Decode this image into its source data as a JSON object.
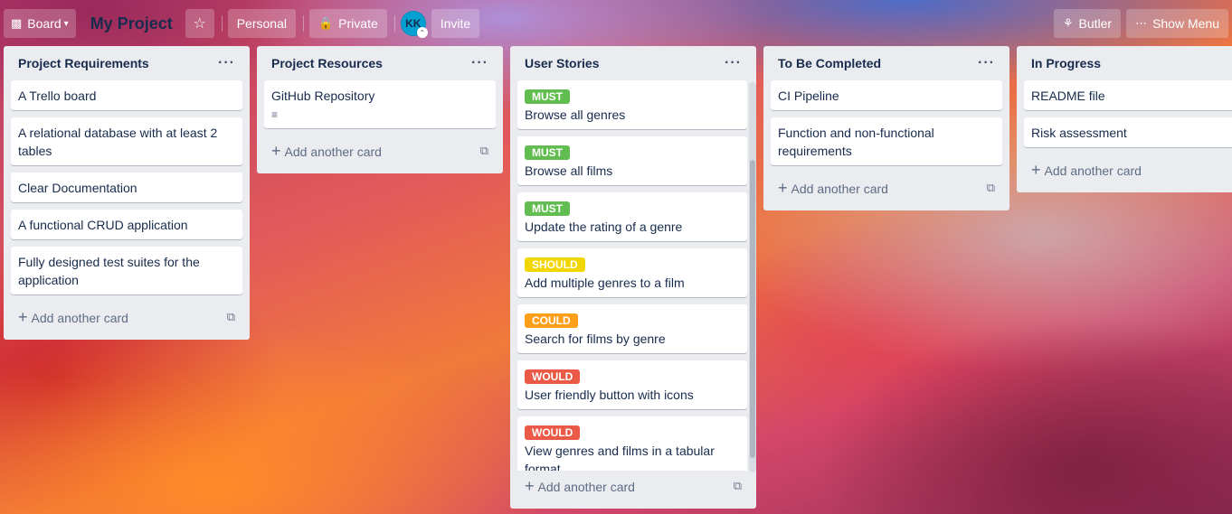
{
  "header": {
    "board_switcher": "Board",
    "board_title": "My Project",
    "team": "Personal",
    "visibility": "Private",
    "avatar_initials": "KK",
    "invite": "Invite",
    "butler": "Butler",
    "show_menu": "Show Menu"
  },
  "common": {
    "add_card": "Add another card"
  },
  "lists": [
    {
      "title": "Project Requirements",
      "cards": [
        {
          "text": "A Trello board"
        },
        {
          "text": "A relational database with at least 2 tables"
        },
        {
          "text": "Clear Documentation"
        },
        {
          "text": "A functional CRUD application"
        },
        {
          "text": "Fully designed test suites for the application"
        }
      ]
    },
    {
      "title": "Project Resources",
      "cards": [
        {
          "text": "GitHub Repository",
          "has_description": true
        }
      ]
    },
    {
      "title": "User Stories",
      "cards": [
        {
          "label": "MUST",
          "label_color": "#61bd4f",
          "text": "Browse all genres"
        },
        {
          "label": "MUST",
          "label_color": "#61bd4f",
          "text": "Browse all films"
        },
        {
          "label": "MUST",
          "label_color": "#61bd4f",
          "text": "Update the rating of a genre"
        },
        {
          "label": "SHOULD",
          "label_color": "#f2d600",
          "text": "Add multiple genres to a film"
        },
        {
          "label": "COULD",
          "label_color": "#ff9f1a",
          "text": "Search for films by genre"
        },
        {
          "label": "WOULD",
          "label_color": "#eb5a46",
          "text": "User friendly button with icons"
        },
        {
          "label": "WOULD",
          "label_color": "#eb5a46",
          "text": "View genres and films in a tabular format"
        }
      ]
    },
    {
      "title": "To Be Completed",
      "cards": [
        {
          "text": "CI Pipeline"
        },
        {
          "text": "Function and non-functional requirements"
        }
      ]
    },
    {
      "title": "In Progress",
      "cards": [
        {
          "text": "README file"
        },
        {
          "text": "Risk assessment"
        }
      ]
    }
  ],
  "icons": {
    "board": "board-icon",
    "star": "star-icon",
    "lock": "lock-icon",
    "butler": "butler-icon",
    "menu": "ellipsis-icon",
    "description": "description-icon",
    "template": "card-template-icon",
    "plus": "plus-icon"
  }
}
